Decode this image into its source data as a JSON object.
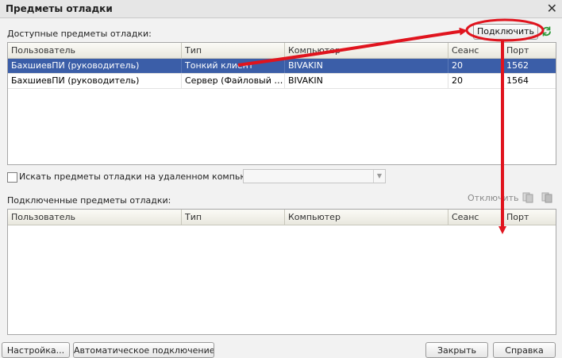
{
  "window": {
    "title": "Предметы отладки"
  },
  "available": {
    "label": "Доступные предметы отладки:",
    "connect_label": "Подключить",
    "columns": [
      "Пользователь",
      "Тип",
      "Компьютер",
      "Сеанс",
      "Порт"
    ],
    "rows": [
      [
        "БахшиевПИ (руководитель)",
        "Тонкий клиент",
        "BIVAKIN",
        "20",
        "1562"
      ],
      [
        "БахшиевПИ (руководитель)",
        "Сервер (Файловый ва...",
        "BIVAKIN",
        "20",
        "1564"
      ]
    ]
  },
  "remote": {
    "checkbox_label": "Искать предметы отладки на удаленном компьютере:",
    "value": ""
  },
  "connected": {
    "label": "Подключенные предметы отладки:",
    "disconnect_label": "Отключить",
    "columns": [
      "Пользователь",
      "Тип",
      "Компьютер",
      "Сеанс",
      "Порт"
    ]
  },
  "footer": {
    "settings": "Настройка...",
    "auto_connect": "Автоматическое подключение...",
    "close": "Закрыть",
    "help": "Справка"
  },
  "colors": {
    "selection": "#3b5ea8",
    "annotation": "#e0141e",
    "refresh": "#2e9a3a"
  }
}
